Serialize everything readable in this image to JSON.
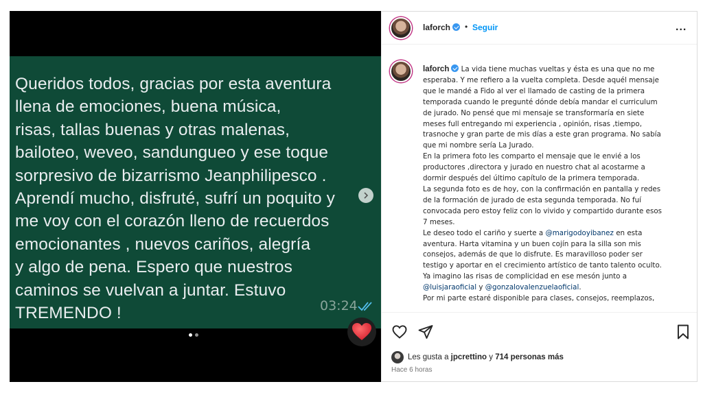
{
  "post_media": {
    "message_lines": [
      "Queridos todos, gracias por esta aventura",
      "llena de emociones, buena música,",
      "risas, tallas buenas y otras malenas,",
      "bailoteo, weveo, sandungueo y ese toque",
      "sorpresivo de bizarrismo Jeanphilipesco .",
      "Aprendí mucho, disfruté, sufrí un poquito y",
      "me voy con el corazón lleno de recuerdos",
      "emocionantes , nuevos cariños, alegría",
      "y algo de pena. Espero que nuestros",
      "caminos se vuelvan a juntar. Estuvo",
      "TREMENDO !"
    ],
    "time": "03:24",
    "carousel_total": 2,
    "carousel_active": 1,
    "reaction_icon": "heart-emoji",
    "colors": {
      "bubble": "#0f4a37",
      "text": "#e9edef",
      "read_ticks": "#53bdeb"
    }
  },
  "header": {
    "username": "laforch",
    "separator": "•",
    "follow_label": "Seguir",
    "more_label": "..."
  },
  "caption": {
    "username": "laforch",
    "lines": [
      [
        "La vida tiene muchas vueltas y ésta es una que no me"
      ],
      [
        "esperaba. Y me refiero a la vuelta completa. Desde aquél mensaje"
      ],
      [
        "que le mandé a Fido al ver el llamado de casting de la primera"
      ],
      [
        "temporada cuando le pregunté dónde debía mandar el curriculum"
      ],
      [
        "de jurado. No pensé que mi mensaje se transformaría en siete"
      ],
      [
        "meses full entregando mi experiencia , opinión, risas ,tiempo,"
      ],
      [
        "trasnoche y gran parte de mis días a este gran programa. No sabía"
      ],
      [
        "que mi nombre sería La Jurado."
      ],
      [
        "En la primera foto les comparto el mensaje que le envié a los"
      ],
      [
        "productores ,directora y jurado en nuestro chat al acostarme a"
      ],
      [
        "dormir después del último capítulo de la primera temporada."
      ],
      [
        "La segunda foto es de hoy, con la confirmación en pantalla y redes"
      ],
      [
        "de la formación de jurado de esta segunda temporada. No fuí"
      ],
      [
        "convocada pero estoy feliz con lo vivido y compartido durante esos"
      ],
      [
        "7 meses."
      ],
      [
        "Le deseo todo el cariño y suerte a ",
        "@marigodoyibanez",
        " en esta"
      ],
      [
        "aventura. Harta vitamina y un buen cojín para la silla son mis"
      ],
      [
        "consejos, además de que lo disfrute. Es maravilloso poder ser"
      ],
      [
        "testigo y aportar en el crecimiento artístico de tanto talento oculto."
      ],
      [
        "Ya imagino las risas de complicidad en ese mesón junto a"
      ],
      [
        "",
        "@luisjaraoficial",
        " y ",
        "@gonzalovalenzuelaoficial",
        "."
      ],
      [
        "Por mi parte estaré disponible para clases, consejos, reemplazos,"
      ]
    ]
  },
  "likes": {
    "prefix": "Les gusta a ",
    "user": "jpcrettino",
    "middle": " y ",
    "others": "714 personas más"
  },
  "time_ago": "Hace 6 horas",
  "colors": {
    "link": "#0095f6",
    "mention": "#00376b",
    "verified": "#3897f0"
  }
}
